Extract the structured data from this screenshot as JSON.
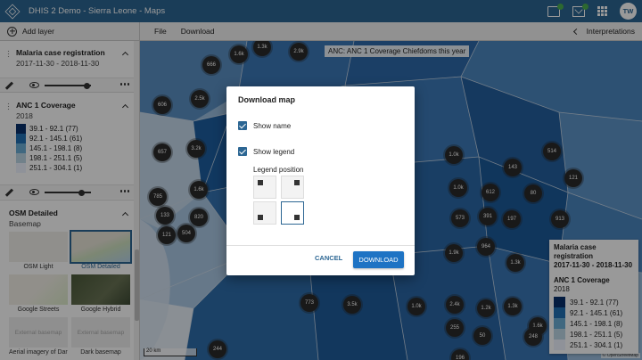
{
  "header": {
    "app_title": "DHIS 2 Demo - Sierra Leone - Maps",
    "avatar_initials": "TW"
  },
  "toolbar": {
    "add_layer": "Add layer",
    "file": "File",
    "download": "Download",
    "interpretations": "Interpretations"
  },
  "layers": [
    {
      "title": "Malaria case registration",
      "subtitle": "2017-11-30 - 2018-11-30"
    },
    {
      "title": "ANC 1 Coverage",
      "subtitle": "2018",
      "legend": [
        {
          "label": "39.1 - 92.1 (77)",
          "color": "#08306b"
        },
        {
          "label": "92.1 - 145.1 (61)",
          "color": "#2171b5"
        },
        {
          "label": "145.1 - 198.1 (8)",
          "color": "#6baed6"
        },
        {
          "label": "198.1 - 251.1 (5)",
          "color": "#bdd7e7"
        },
        {
          "label": "251.1 - 304.1 (1)",
          "color": "#eff3ff"
        }
      ]
    }
  ],
  "basemap": {
    "title": "OSM Detailed",
    "subtitle": "Basemap",
    "options": [
      {
        "label": "OSM Light"
      },
      {
        "label": "OSM Detailed"
      },
      {
        "label": "Google Streets"
      },
      {
        "label": "Google Hybrid"
      },
      {
        "label": "Aerial imagery of Dar...",
        "thumb_text": "External basemap"
      },
      {
        "label": "Dark basemap",
        "thumb_text": "External basemap"
      }
    ]
  },
  "map": {
    "title": "ANC: ANC 1 Coverage Chiefdoms this year",
    "scale": "20 km",
    "attribution": "© OpenStreetMap",
    "clusters": [
      "1.3k",
      "2.9k",
      "1.6k",
      "666",
      "2.5k",
      "606",
      "657",
      "3.2k",
      "1.6k",
      "785",
      "133",
      "820",
      "121",
      "504",
      "514",
      "1.0k",
      "143",
      "121",
      "1.0k",
      "612",
      "80",
      "573",
      "391",
      "197",
      "913",
      "964",
      "1.9k",
      "1.3k",
      "773",
      "3.5k",
      "1.0k",
      "2.4k",
      "1.2k",
      "1.3k",
      "1.6k",
      "244",
      "255",
      "248",
      "196",
      "50"
    ]
  },
  "map_legend": {
    "title": "Malaria case registration",
    "period": "2017-11-30 - 2018-11-30",
    "sub_title": "ANC 1 Coverage",
    "sub_period": "2018"
  },
  "dialog": {
    "title": "Download map",
    "show_name": "Show name",
    "show_legend": "Show legend",
    "legend_position": "Legend position",
    "cancel": "CANCEL",
    "download": "DOWNLOAD"
  }
}
